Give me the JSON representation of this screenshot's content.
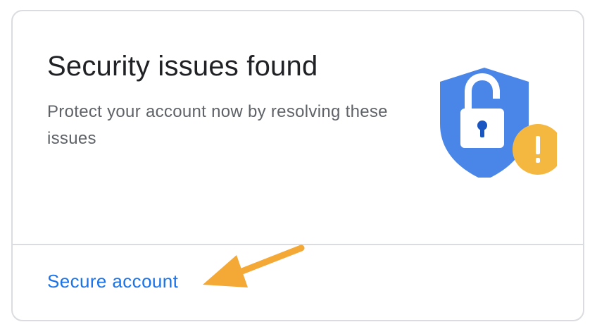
{
  "card": {
    "title": "Security issues found",
    "description": "Protect your account now by resolving these issues",
    "illustration_icon": "shield-lock-warning-icon",
    "action_label": "Secure account"
  },
  "colors": {
    "title": "#202124",
    "description": "#5f6368",
    "link": "#1a73e8",
    "shield": "#4a86e8",
    "warning_badge": "#f4b740",
    "annotation_arrow": "#f4a836",
    "border": "#dadce0"
  }
}
